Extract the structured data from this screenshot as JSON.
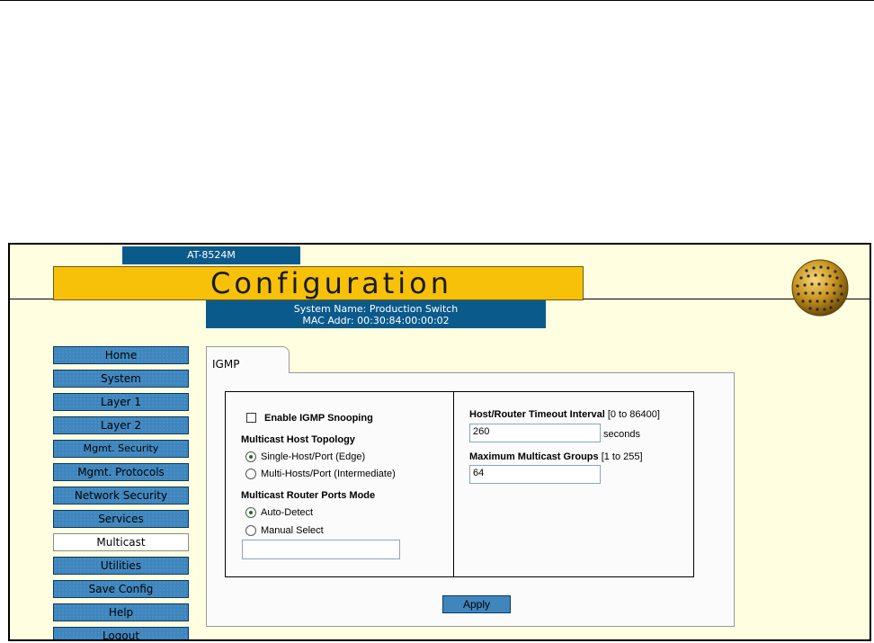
{
  "header": {
    "model": "AT-8524M",
    "title": "Configuration",
    "system_name": "System Name: Production Switch",
    "mac_addr": "MAC Addr: 00:30:84:00:00:02"
  },
  "nav": {
    "items": [
      {
        "label": "Home"
      },
      {
        "label": "System"
      },
      {
        "label": "Layer 1"
      },
      {
        "label": "Layer 2"
      },
      {
        "label": "Mgmt. Security"
      },
      {
        "label": "Mgmt. Protocols"
      },
      {
        "label": "Network Security"
      },
      {
        "label": "Services"
      },
      {
        "label": "Multicast"
      },
      {
        "label": "Utilities"
      },
      {
        "label": "Save Config"
      },
      {
        "label": "Help"
      },
      {
        "label": "Logout"
      }
    ],
    "active": "Multicast"
  },
  "tab": {
    "label": "IGMP"
  },
  "form": {
    "enable_snooping_label": "Enable IGMP Snooping",
    "enable_snooping_checked": false,
    "topology_heading": "Multicast Host Topology",
    "topology_options": [
      "Single-Host/Port (Edge)",
      "Multi-Hosts/Port (Intermediate)"
    ],
    "topology_selected": "Single-Host/Port (Edge)",
    "router_mode_heading": "Multicast Router Ports Mode",
    "router_mode_options": [
      "Auto-Detect",
      "Manual Select"
    ],
    "router_mode_selected": "Auto-Detect",
    "manual_ports_value": "",
    "timeout_label": "Host/Router Timeout Interval",
    "timeout_range": "[0 to 86400]",
    "timeout_value": "260",
    "timeout_unit": "seconds",
    "max_groups_label": "Maximum Multicast Groups",
    "max_groups_range": "[1 to 255]",
    "max_groups_value": "64",
    "apply_label": "Apply"
  },
  "colors": {
    "frame_bg": "#fffee0",
    "brand_blue": "#0b5a8c",
    "banner_yellow": "#f7c10a",
    "button_blue": "#3f86be"
  },
  "icons": {
    "logo": "globe-logo-icon"
  }
}
